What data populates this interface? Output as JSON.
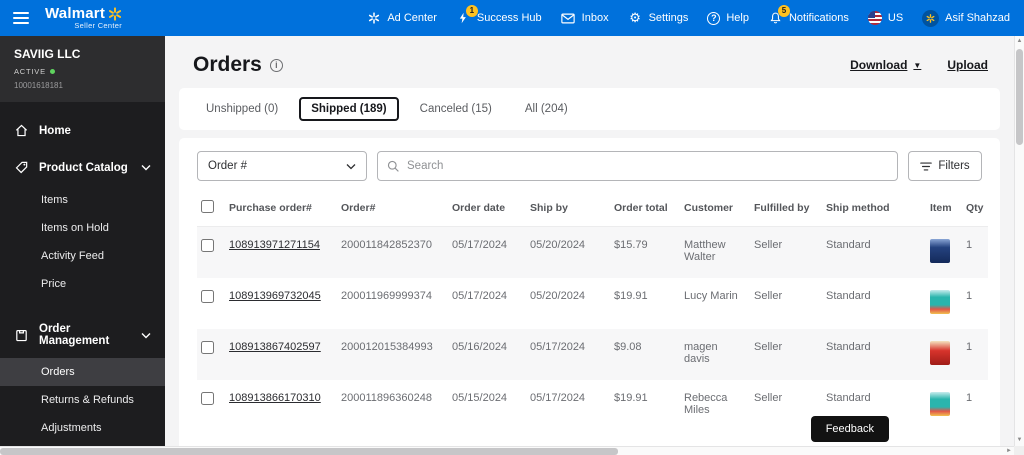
{
  "brand": {
    "name": "Walmart",
    "subtitle": "Seller Center",
    "blue": "#0071dc",
    "yellow": "#ffc220"
  },
  "topnav": {
    "items": [
      {
        "label": "Ad Center"
      },
      {
        "label": "Success Hub",
        "badge": "1"
      },
      {
        "label": "Inbox"
      },
      {
        "label": "Settings"
      },
      {
        "label": "Help"
      },
      {
        "label": "Notifications",
        "badge": "5"
      },
      {
        "label": "US"
      },
      {
        "label": "Asif Shahzad"
      }
    ]
  },
  "sidebar": {
    "company_name": "SAVIIG LLC",
    "status": "ACTIVE",
    "seller_id": "10001618181",
    "home_label": "Home",
    "product_catalog_label": "Product Catalog",
    "catalog_items": [
      "Items",
      "Items on Hold",
      "Activity Feed",
      "Price"
    ],
    "order_management_label": "Order Management",
    "order_items": [
      "Orders",
      "Returns & Refunds",
      "Adjustments"
    ],
    "active_item": "Orders"
  },
  "main": {
    "title": "Orders",
    "download_label": "Download",
    "upload_label": "Upload",
    "tabs": [
      {
        "label": "Unshipped (0)"
      },
      {
        "label": "Shipped (189)",
        "active": true
      },
      {
        "label": "Canceled (15)"
      },
      {
        "label": "All (204)"
      }
    ],
    "filter": {
      "dropdown_value": "Order #",
      "search_placeholder": "Search",
      "filters_label": "Filters"
    },
    "table": {
      "headers": [
        "Purchase order#",
        "Order#",
        "Order date",
        "Ship by",
        "Order total",
        "Customer",
        "Fulfilled by",
        "Ship method",
        "Item",
        "Qty"
      ],
      "rows": [
        {
          "purchase_order": "108913971271154",
          "order_number": "200011842852370",
          "order_date": "05/17/2024",
          "ship_by": "05/20/2024",
          "order_total": "$15.79",
          "customer": "Matthew Walter",
          "fulfilled_by": "Seller",
          "ship_method": "Standard",
          "qty": "1"
        },
        {
          "purchase_order": "108913969732045",
          "order_number": "200011969999374",
          "order_date": "05/17/2024",
          "ship_by": "05/20/2024",
          "order_total": "$19.91",
          "customer": "Lucy Marin",
          "fulfilled_by": "Seller",
          "ship_method": "Standard",
          "qty": "1"
        },
        {
          "purchase_order": "108913867402597",
          "order_number": "200012015384993",
          "order_date": "05/16/2024",
          "ship_by": "05/17/2024",
          "order_total": "$9.08",
          "customer": "magen davis",
          "fulfilled_by": "Seller",
          "ship_method": "Standard",
          "qty": "1"
        },
        {
          "purchase_order": "108913866170310",
          "order_number": "200011896360248",
          "order_date": "05/15/2024",
          "ship_by": "05/17/2024",
          "order_total": "$19.91",
          "customer": "Rebecca Miles",
          "fulfilled_by": "Seller",
          "ship_method": "Standard",
          "qty": "1"
        }
      ]
    },
    "feedback_label": "Feedback"
  }
}
